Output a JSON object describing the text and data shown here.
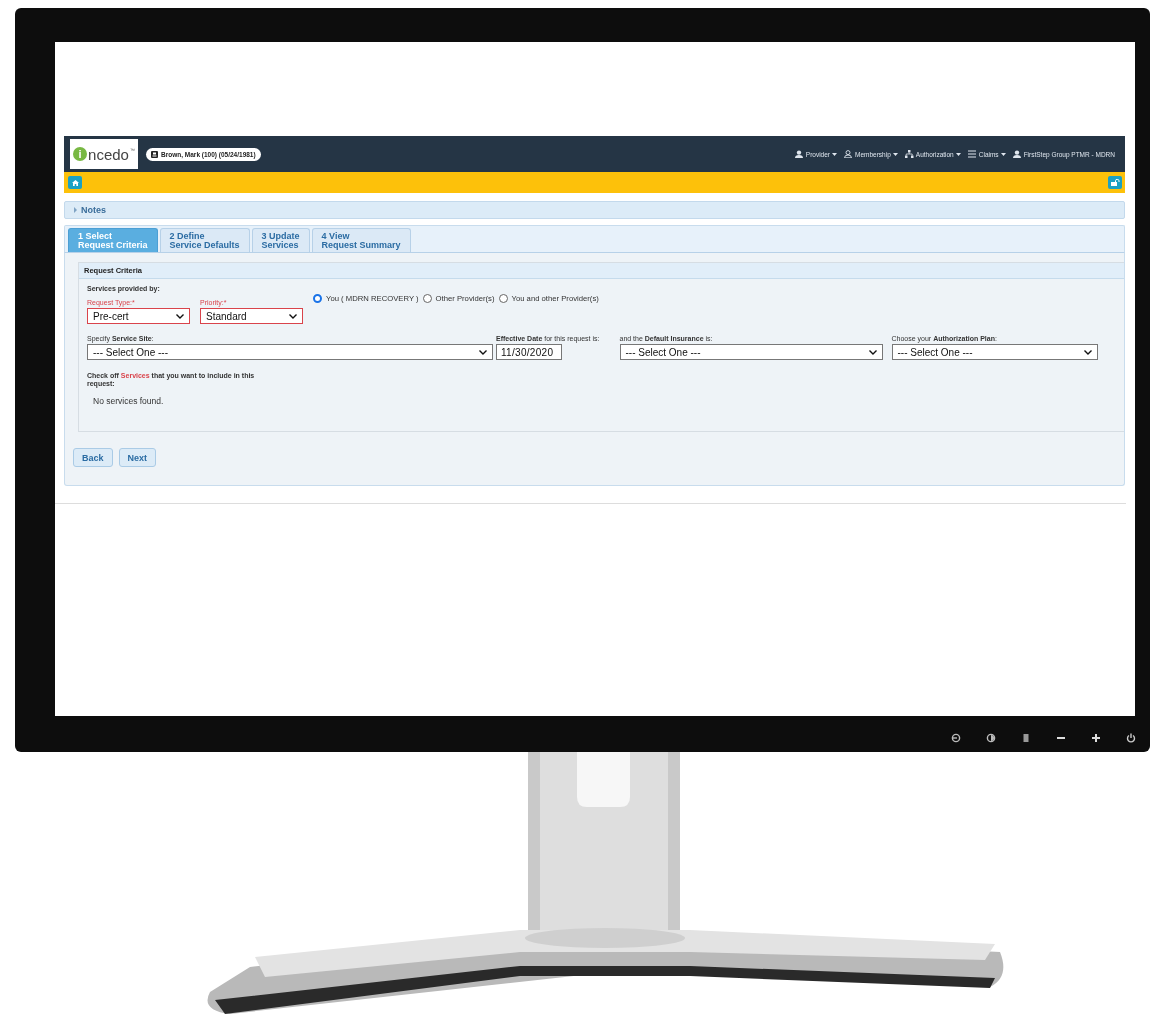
{
  "header": {
    "logo": {
      "mark": "i",
      "text": "ncedo",
      "trademark": "™"
    },
    "patient": "Brown, Mark (100) (05/24/1981)",
    "nav": [
      {
        "kind": "person",
        "label": "Provider",
        "dropdown": true
      },
      {
        "kind": "person-outline",
        "label": "Membership",
        "dropdown": true
      },
      {
        "kind": "sitemap",
        "label": "Authorization",
        "dropdown": true
      },
      {
        "kind": "list",
        "label": "Claims",
        "dropdown": true
      },
      {
        "kind": "person",
        "label": "FirstStep Group PTMR - MDRN",
        "dropdown": false
      }
    ]
  },
  "notes": {
    "label": "Notes",
    "expanded": false
  },
  "tabs": [
    {
      "number": "1",
      "line1": "Select",
      "line2": "Request Criteria",
      "selected": true
    },
    {
      "number": "2",
      "line1": "Define",
      "line2": "Service Defaults",
      "selected": false
    },
    {
      "number": "3",
      "line1": "Update",
      "line2": "Services",
      "selected": false
    },
    {
      "number": "4",
      "line1": "View",
      "line2": "Request Summary",
      "selected": false
    }
  ],
  "section": {
    "title": "Request Criteria",
    "subtitle": "Services provided by:",
    "row1": [
      {
        "kind": "select",
        "label": "Request Type:*",
        "value": "Pre-cert",
        "required": true
      },
      {
        "kind": "select",
        "label": "Priority:*",
        "value": "Standard",
        "required": true
      }
    ],
    "radios": [
      {
        "label": "You ( MDRN RECOVERY )",
        "selected": true
      },
      {
        "label": "Other Provider(s)",
        "selected": false
      },
      {
        "label": "You and other Provider(s)",
        "selected": false
      }
    ],
    "row2": [
      {
        "kind": "select",
        "label": "Specify **Service Site**:",
        "value": "--- Select One ---"
      },
      {
        "kind": "date",
        "label": "**Effective Date** for this request is:",
        "value": "11/30/2020"
      },
      {
        "kind": "select",
        "label": "and the **Default Insurance** is:",
        "value": "--- Select One ---"
      },
      {
        "kind": "select",
        "label": "Choose your **Authorization Plan**:",
        "value": "--- Select One ---"
      }
    ],
    "services_prompt": {
      "before": "Check off ",
      "highlight": "Services",
      "after": " that you want to include in this request:"
    },
    "empty_message": "No services found."
  },
  "buttons": [
    "Back",
    "Next"
  ]
}
